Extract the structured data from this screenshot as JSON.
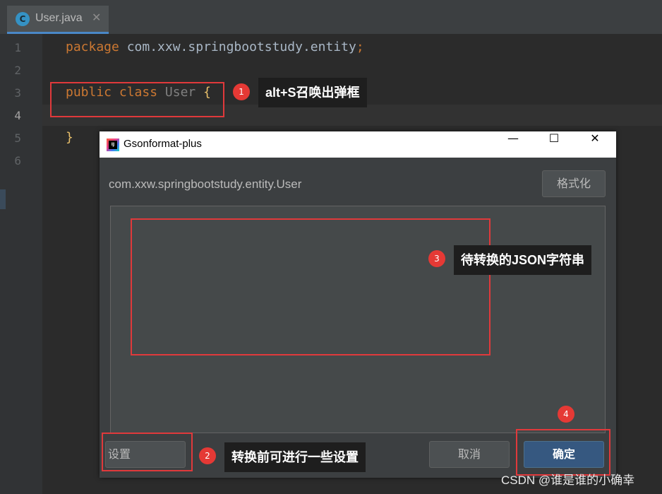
{
  "editor": {
    "tab": {
      "icon": "C",
      "label": "User.java",
      "close": "✕"
    },
    "line_numbers": [
      "1",
      "2",
      "3",
      "4",
      "5",
      "6"
    ],
    "code": {
      "line1_keyword": "package",
      "line1_rest": " com.xxw.springbootstudy.entity",
      "line1_semi": ";",
      "line3_public": "public",
      "line3_class": "class",
      "line3_name": "User",
      "line3_brace": "{",
      "line5_brace": "}"
    }
  },
  "annotations": {
    "a1": {
      "number": "1",
      "text": "alt+S召唤出弹框"
    },
    "a2": {
      "number": "2",
      "text": "转换前可进行一些设置"
    },
    "a3": {
      "number": "3",
      "text": "待转换的JSON字符串"
    },
    "a4": {
      "number": "4"
    }
  },
  "dialog": {
    "title": "Gsonformat-plus",
    "window_buttons": {
      "minimize": "—",
      "maximize": "☐",
      "close": "✕"
    },
    "entity_path": "com.xxw.springbootstudy.entity.User",
    "format_button": "格式化",
    "json_input_value": "",
    "settings_button": "设置",
    "cancel_button": "取消",
    "ok_button": "确定"
  },
  "watermark": "CSDN @谁是谁的小确幸",
  "colors": {
    "editor_bg": "#2b2b2b",
    "keyword": "#cc7832",
    "annotation_red": "#e0393b",
    "ok_button": "#365880"
  }
}
